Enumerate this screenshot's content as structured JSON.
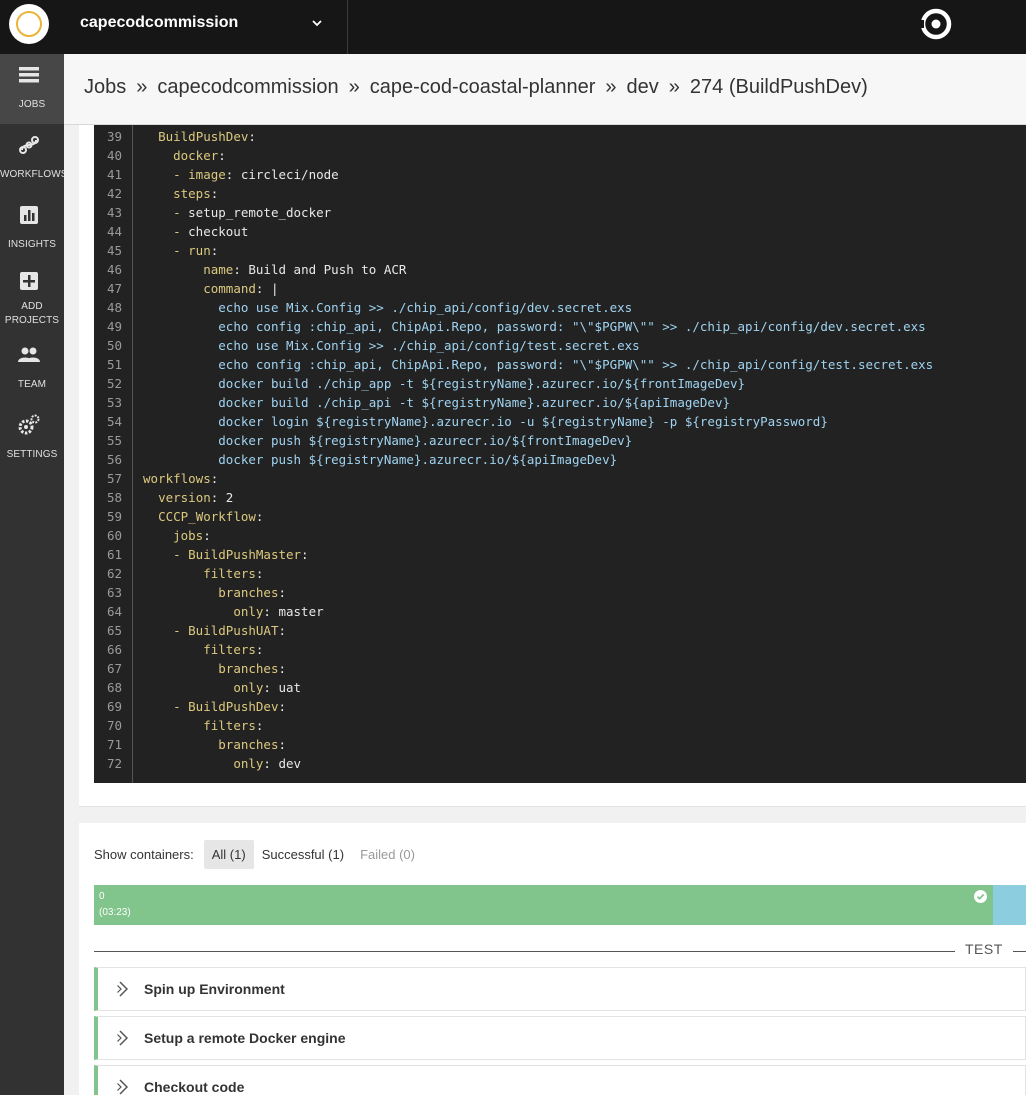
{
  "topbar": {
    "org_name": "capecodcommission"
  },
  "sidebar": {
    "items": [
      {
        "label": "JOBS",
        "icon": "jobs-icon"
      },
      {
        "label": "WORKFLOWS",
        "icon": "workflows-icon"
      },
      {
        "label": "INSIGHTS",
        "icon": "insights-icon"
      },
      {
        "label": "ADD",
        "label2": "PROJECTS",
        "icon": "add-projects-icon"
      },
      {
        "label": "TEAM",
        "icon": "team-icon"
      },
      {
        "label": "SETTINGS",
        "icon": "settings-icon"
      }
    ]
  },
  "breadcrumb": {
    "items": [
      "Jobs",
      "capecodcommission",
      "cape-cod-coastal-planner",
      "dev",
      "274 (BuildPushDev)"
    ],
    "separator": "»"
  },
  "code": {
    "lines": [
      {
        "n": "39",
        "indent": "  ",
        "key": "BuildPushDev",
        "colon": ":",
        "val": ""
      },
      {
        "n": "40",
        "indent": "    ",
        "key": "docker",
        "colon": ":",
        "val": ""
      },
      {
        "n": "41",
        "indent": "    - ",
        "key": "image",
        "colon": ":",
        "val": " circleci/node"
      },
      {
        "n": "42",
        "indent": "    ",
        "key": "steps",
        "colon": ":",
        "val": ""
      },
      {
        "n": "43",
        "indent": "    - ",
        "key": "",
        "colon": "",
        "val": "setup_remote_docker"
      },
      {
        "n": "44",
        "indent": "    - ",
        "key": "",
        "colon": "",
        "val": "checkout"
      },
      {
        "n": "45",
        "indent": "    - ",
        "key": "run",
        "colon": ":",
        "val": ""
      },
      {
        "n": "46",
        "indent": "        ",
        "key": "name",
        "colon": ":",
        "val": " Build and Push to ACR"
      },
      {
        "n": "47",
        "indent": "        ",
        "key": "command",
        "colon": ":",
        "val": " |"
      },
      {
        "n": "48",
        "indent": "          ",
        "key": "",
        "colon": "",
        "str": "echo use Mix.Config >> ./chip_api/config/dev.secret.exs"
      },
      {
        "n": "49",
        "indent": "          ",
        "key": "",
        "colon": "",
        "str": "echo config :chip_api, ChipApi.Repo, password: \"\\\"$PGPW\\\"\" >> ./chip_api/config/dev.secret.exs"
      },
      {
        "n": "50",
        "indent": "          ",
        "key": "",
        "colon": "",
        "str": "echo use Mix.Config >> ./chip_api/config/test.secret.exs"
      },
      {
        "n": "51",
        "indent": "          ",
        "key": "",
        "colon": "",
        "str": "echo config :chip_api, ChipApi.Repo, password: \"\\\"$PGPW\\\"\" >> ./chip_api/config/test.secret.exs"
      },
      {
        "n": "52",
        "indent": "          ",
        "key": "",
        "colon": "",
        "str": "docker build ./chip_app -t ${registryName}.azurecr.io/${frontImageDev}"
      },
      {
        "n": "53",
        "indent": "          ",
        "key": "",
        "colon": "",
        "str": "docker build ./chip_api -t ${registryName}.azurecr.io/${apiImageDev}"
      },
      {
        "n": "54",
        "indent": "          ",
        "key": "",
        "colon": "",
        "str": "docker login ${registryName}.azurecr.io -u ${registryName} -p ${registryPassword}"
      },
      {
        "n": "55",
        "indent": "          ",
        "key": "",
        "colon": "",
        "str": "docker push ${registryName}.azurecr.io/${frontImageDev}"
      },
      {
        "n": "56",
        "indent": "          ",
        "key": "",
        "colon": "",
        "str": "docker push ${registryName}.azurecr.io/${apiImageDev}"
      },
      {
        "n": "57",
        "indent": "",
        "key": "workflows",
        "colon": ":",
        "val": ""
      },
      {
        "n": "58",
        "indent": "  ",
        "key": "version",
        "colon": ":",
        "val": " 2"
      },
      {
        "n": "59",
        "indent": "  ",
        "key": "CCCP_Workflow",
        "colon": ":",
        "val": ""
      },
      {
        "n": "60",
        "indent": "    ",
        "key": "jobs",
        "colon": ":",
        "val": ""
      },
      {
        "n": "61",
        "indent": "    - ",
        "key": "BuildPushMaster",
        "colon": ":",
        "val": ""
      },
      {
        "n": "62",
        "indent": "        ",
        "key": "filters",
        "colon": ":",
        "val": ""
      },
      {
        "n": "63",
        "indent": "          ",
        "key": "branches",
        "colon": ":",
        "val": ""
      },
      {
        "n": "64",
        "indent": "            ",
        "key": "only",
        "colon": ":",
        "val": " master"
      },
      {
        "n": "65",
        "indent": "    - ",
        "key": "BuildPushUAT",
        "colon": ":",
        "val": ""
      },
      {
        "n": "66",
        "indent": "        ",
        "key": "filters",
        "colon": ":",
        "val": ""
      },
      {
        "n": "67",
        "indent": "          ",
        "key": "branches",
        "colon": ":",
        "val": ""
      },
      {
        "n": "68",
        "indent": "            ",
        "key": "only",
        "colon": ":",
        "val": " uat"
      },
      {
        "n": "69",
        "indent": "    - ",
        "key": "BuildPushDev",
        "colon": ":",
        "val": ""
      },
      {
        "n": "70",
        "indent": "        ",
        "key": "filters",
        "colon": ":",
        "val": ""
      },
      {
        "n": "71",
        "indent": "          ",
        "key": "branches",
        "colon": ":",
        "val": ""
      },
      {
        "n": "72",
        "indent": "            ",
        "key": "only",
        "colon": ":",
        "val": " dev"
      }
    ]
  },
  "containers": {
    "label": "Show containers:",
    "filters": {
      "all": "All (1)",
      "successful": "Successful (1)",
      "failed": "Failed (0)"
    },
    "bar": {
      "index": "0",
      "duration": "(03:23)",
      "status": "success"
    },
    "section_label": "TEST",
    "steps": [
      "Spin up Environment",
      "Setup a remote Docker engine",
      "Checkout code"
    ]
  },
  "colors": {
    "success": "#81c48c",
    "running": "#8dcde0",
    "code_bg": "#222222",
    "sidebar_bg": "#323232"
  }
}
